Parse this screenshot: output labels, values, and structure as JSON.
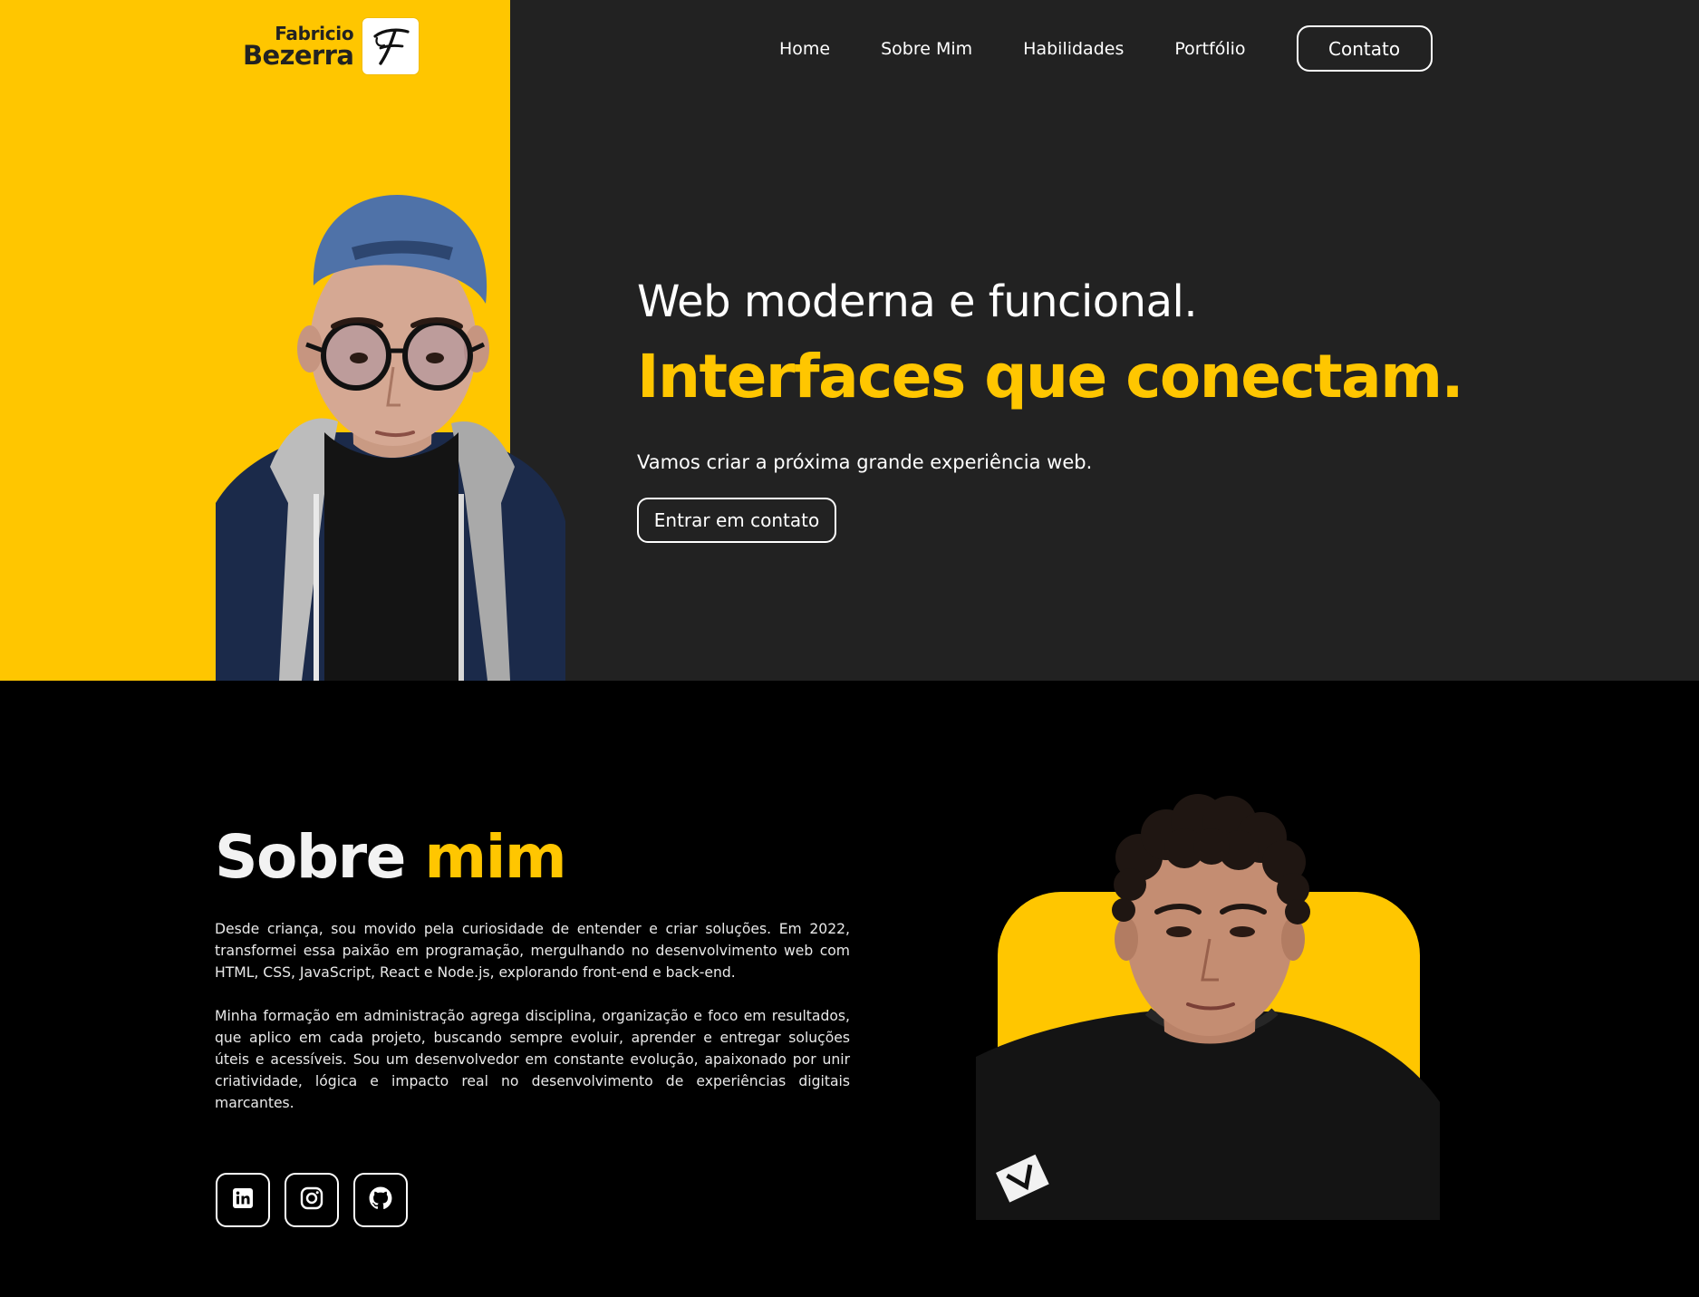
{
  "brand": {
    "first_name": "Fabricio",
    "last_name": "Bezerra",
    "mark": "F"
  },
  "nav": {
    "items": [
      {
        "label": "Home"
      },
      {
        "label": "Sobre Mim"
      },
      {
        "label": "Habilidades"
      },
      {
        "label": "Portfólio"
      }
    ],
    "contact_label": "Contato"
  },
  "hero": {
    "subtitle": "Web moderna e funcional.",
    "title": "Interfaces que conectam.",
    "description": "Vamos criar a próxima grande experiência web.",
    "cta_label": "Entrar em contato"
  },
  "about": {
    "title_part1": "Sobre",
    "title_part2": "mim",
    "paragraphs": [
      "Desde criança, sou movido pela curiosidade de entender e criar soluções. Em 2022, transformei essa paixão em programação, mergulhando no desenvolvimento web com HTML, CSS, JavaScript, React e Node.js, explorando front-end e back-end.",
      "Minha formação em administração agrega disciplina, organização e foco em resultados, que aplico em cada projeto, buscando sempre evoluir, aprender e entregar soluções úteis e acessíveis. Sou um desenvolvedor em constante evolução, apaixonado por unir criatividade, lógica e impacto real no desenvolvimento de experiências digitais marcantes."
    ],
    "socials": [
      {
        "icon": "linkedin-icon"
      },
      {
        "icon": "instagram-icon"
      },
      {
        "icon": "github-icon"
      }
    ]
  },
  "colors": {
    "accent": "#FFC600",
    "hero_bg": "#222222",
    "about_bg": "#000000"
  }
}
